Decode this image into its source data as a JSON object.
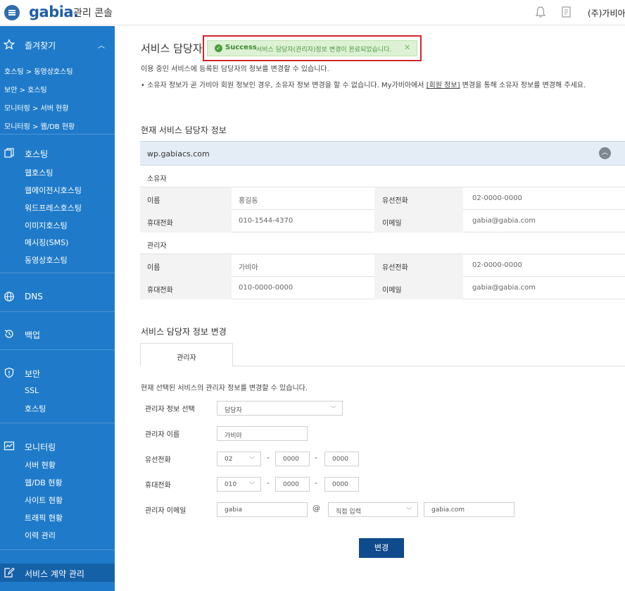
{
  "header": {
    "logo": "gabia.",
    "console_label": "관리 콘솔",
    "company": "(주)가비아"
  },
  "sidebar": {
    "favorites": {
      "label": "즐겨찾기",
      "items": [
        "호스팅 > 동영상호스팅",
        "보안 > 호스팅",
        "모니터링 > 서버 현황",
        "모니터링 > 웹/DB 현황"
      ]
    },
    "hosting": {
      "label": "호스팅",
      "items": [
        "웹호스팅",
        "웹에이전시호스팅",
        "워드프레스호스팅",
        "이미지호스팅",
        "메시징(SMS)",
        "동영상호스팅"
      ]
    },
    "dns": {
      "label": "DNS"
    },
    "backup": {
      "label": "백업"
    },
    "security": {
      "label": "보안",
      "items": [
        "SSL",
        "호스팅"
      ]
    },
    "monitoring": {
      "label": "모니터링",
      "items": [
        "서버 현황",
        "웹/DB 현황",
        "사이트 현황",
        "트래픽 현황",
        "이력 관리"
      ]
    },
    "contract": {
      "label": "서비스 계약 관리"
    }
  },
  "main": {
    "title": "서비스 담당자",
    "toast": {
      "title": "Success",
      "message": "서비스 담당자(관리자)정보 변경이 완료되었습니다.",
      "close": "✕"
    },
    "intro": "이용 중인 서비스에 등록된 담당자의 정보를 변경할 수 있습니다.",
    "bullet_pre": "• 소유자 정보가 곧 가비아 회원 정보인 경우, 소유자 정보 변경을 할 수 없습니다. My가비아에서 ",
    "bullet_link": "[회원 정보]",
    "bullet_post": " 변경을 통해 소유자 정보를 변경해 주세요.",
    "current_section_title": "현재 서비스 담당자 정보",
    "domain": "wp.gabiacs.com",
    "owner": {
      "group_label": "소유자",
      "name_label": "이름",
      "name": "홍길동",
      "phone_label": "유선전화",
      "phone": "02-0000-0000",
      "mobile_label": "휴대전화",
      "mobile": "010-1544-4370",
      "email_label": "이메일",
      "email": "gabia@gabia.com"
    },
    "admin": {
      "group_label": "관리자",
      "name_label": "이름",
      "name": "가비아",
      "phone_label": "유선전화",
      "phone": "02-0000-0000",
      "mobile_label": "휴대전화",
      "mobile": "010-0000-0000",
      "email_label": "이메일",
      "email": "gabia@gabia.com"
    },
    "change_section_title": "서비스 담당자 정보 변경",
    "tab_label": "관리자",
    "form": {
      "description": "현재 선택된 서비스의 관리자 정보를 변경할 수 있습니다.",
      "select_label": "관리자 정보 선택",
      "select_value": "담당자",
      "name_label": "관리자 이름",
      "name_value": "가비아",
      "phone_label": "유선전화",
      "phone_prefix": "02",
      "phone_mid": "0000",
      "phone_last": "0000",
      "mobile_label": "휴대전화",
      "mobile_prefix": "010",
      "mobile_mid": "0000",
      "mobile_last": "0000",
      "email_label": "관리자 이메일",
      "email_id": "gabia",
      "email_at": "@",
      "email_domain_select": "직접 입력",
      "email_domain": "gabia.com",
      "submit": "변경"
    }
  }
}
